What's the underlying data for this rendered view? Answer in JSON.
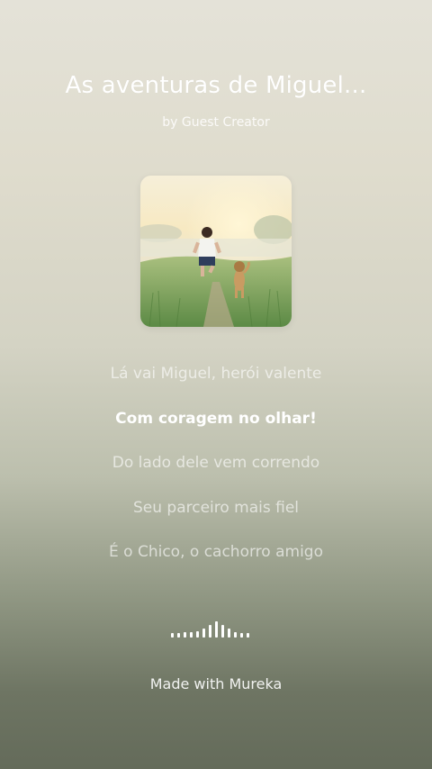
{
  "song": {
    "title": "As aventuras de Miguel...",
    "byline": "by Guest Creator"
  },
  "lyrics": [
    {
      "text": "Lá vai Miguel, herói valente",
      "active": false
    },
    {
      "text": "Com coragem no olhar!",
      "active": true
    },
    {
      "text": "Do lado dele vem correndo",
      "active": false
    },
    {
      "text": "Seu parceiro mais fiel",
      "active": false
    },
    {
      "text": "É o Chico, o cachorro amigo",
      "active": false
    }
  ],
  "visualizer": {
    "icon": "audio-waveform-icon",
    "bar_levels": [
      0.3,
      0.3,
      0.35,
      0.35,
      0.4,
      0.55,
      0.75,
      1.0,
      0.75,
      0.55,
      0.35,
      0.3,
      0.3
    ]
  },
  "footer": {
    "credit": "Made with Mureka"
  },
  "colors": {
    "text": "#ffffff",
    "background_top": "#e4e2d8",
    "background_bottom": "#646b5a"
  }
}
